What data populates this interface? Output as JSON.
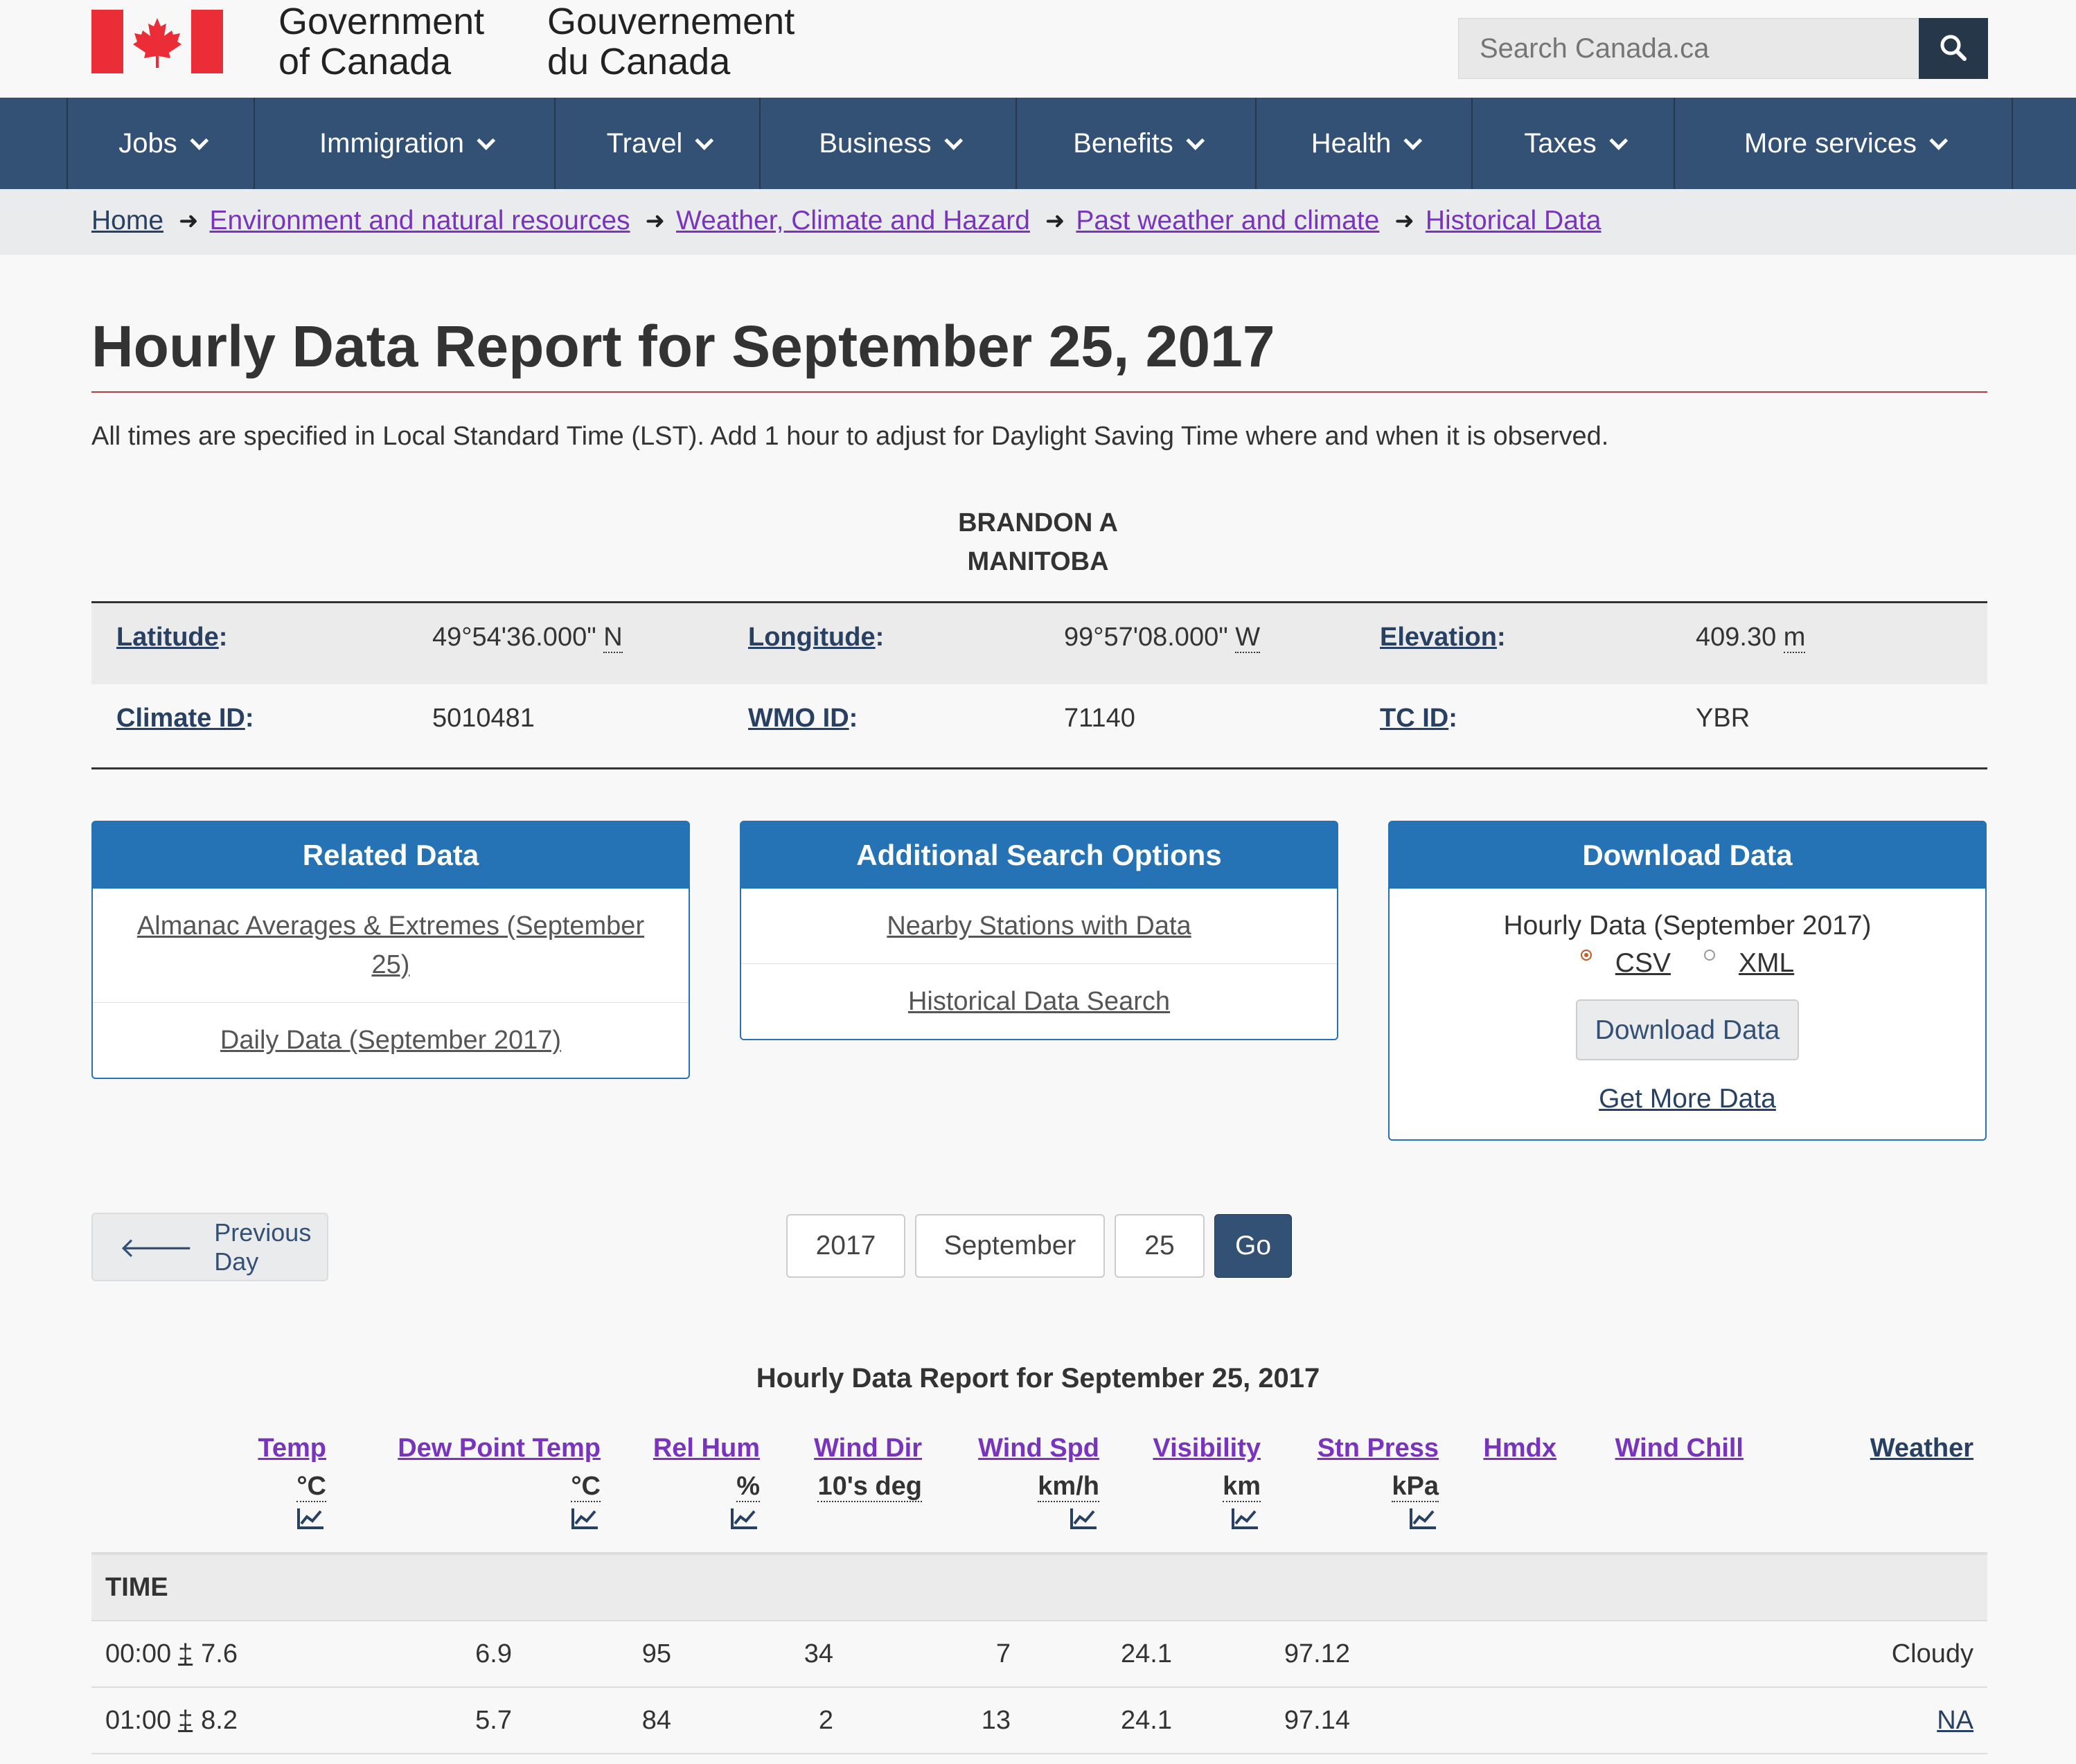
{
  "header": {
    "signature_en_line1": "Government",
    "signature_en_line2": "of Canada",
    "signature_fr_line1": "Gouvernement",
    "signature_fr_line2": "du Canada",
    "search_placeholder": "Search Canada.ca"
  },
  "nav": {
    "items": [
      {
        "label": "Jobs"
      },
      {
        "label": "Immigration"
      },
      {
        "label": "Travel"
      },
      {
        "label": "Business"
      },
      {
        "label": "Benefits"
      },
      {
        "label": "Health"
      },
      {
        "label": "Taxes"
      },
      {
        "label": "More services"
      }
    ]
  },
  "breadcrumb": [
    "Home",
    "Environment and natural resources",
    "Weather, Climate and Hazard",
    "Past weather and climate",
    "Historical Data"
  ],
  "page": {
    "title": "Hourly Data Report for September 25, 2017",
    "note": "All times are specified in Local Standard Time (LST). Add 1 hour to adjust for Daylight Saving Time where and when it is observed.",
    "station_name": "BRANDON A",
    "province": "MANITOBA"
  },
  "station": {
    "latitude_label": "Latitude",
    "latitude_value": "49°54'36.000\"",
    "latitude_dir": "N",
    "longitude_label": "Longitude",
    "longitude_value": "99°57'08.000\"",
    "longitude_dir": "W",
    "elevation_label": "Elevation",
    "elevation_value": "409.30",
    "elevation_unit": "m",
    "climate_id_label": "Climate ID",
    "climate_id_value": "5010481",
    "wmo_id_label": "WMO ID",
    "wmo_id_value": "71140",
    "tc_id_label": "TC ID",
    "tc_id_value": "YBR"
  },
  "panels": {
    "related": {
      "title": "Related Data",
      "links": [
        "Almanac Averages & Extremes (September 25)",
        "Daily Data (September 2017)"
      ]
    },
    "search": {
      "title": "Additional Search Options",
      "links": [
        "Nearby Stations with Data",
        "Historical Data Search"
      ]
    },
    "download": {
      "title": "Download Data",
      "subtitle": "Hourly Data (September 2017)",
      "option_csv": "CSV",
      "option_xml": "XML",
      "selected": "CSV",
      "button": "Download Data",
      "more_link": "Get More Data"
    }
  },
  "date_nav": {
    "prev": "Previous Day",
    "year": "2017",
    "month": "September",
    "day": "25",
    "go": "Go"
  },
  "hourly": {
    "caption": "Hourly Data Report for September 25, 2017",
    "time_label": "TIME",
    "columns": [
      {
        "name": "Temp",
        "unit": "°C",
        "chart": true
      },
      {
        "name": "Dew Point Temp",
        "unit": "°C",
        "chart": true
      },
      {
        "name": "Rel Hum",
        "unit": "%",
        "chart": true
      },
      {
        "name": "Wind Dir",
        "unit": "10's deg",
        "chart": false
      },
      {
        "name": "Wind Spd",
        "unit": "km/h",
        "chart": true
      },
      {
        "name": "Visibility",
        "unit": "km",
        "chart": true
      },
      {
        "name": "Stn Press",
        "unit": "kPa",
        "chart": true
      },
      {
        "name": "Hmdx",
        "unit": "",
        "chart": false
      },
      {
        "name": "Wind Chill",
        "unit": "",
        "chart": false
      },
      {
        "name": "Weather",
        "unit": "",
        "chart": false
      }
    ],
    "rows": [
      {
        "time": "00:00",
        "flag": "‡",
        "values": [
          "7.6",
          "6.9",
          "95",
          "34",
          "7",
          "24.1",
          "97.12",
          "",
          "",
          "Cloudy"
        ]
      },
      {
        "time": "01:00",
        "flag": "‡",
        "values": [
          "8.2",
          "5.7",
          "84",
          "2",
          "13",
          "24.1",
          "97.14",
          "",
          "",
          "NA"
        ]
      }
    ]
  },
  "colors": {
    "nav_bg": "#335075",
    "panel_blue": "#2572b4",
    "link_purple": "#7834bc",
    "flag_red": "#eb2d37",
    "title_rule": "#af3c43"
  }
}
